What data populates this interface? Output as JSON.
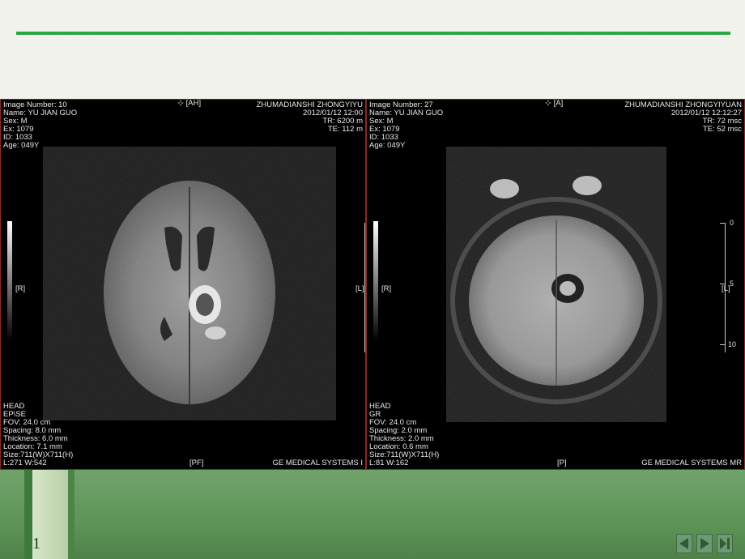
{
  "slide": {
    "number": "1"
  },
  "panels": [
    {
      "image_number": "Image Number: 10",
      "name": "Name: YU JIAN  GUO",
      "sex": "Sex: M",
      "ex": "Ex: 1079",
      "id": "ID: 1033",
      "age": "Age: 049Y",
      "orient_top": "[AH]",
      "hospital": "ZHUMADIANSHI ZHONGYIYU",
      "datetime": "2012/01/12 12:00",
      "tr": "TR: 6200 m",
      "te": "TE: 112 m",
      "side_left": "[R]",
      "side_right": "[L]",
      "region": "HEAD",
      "sequence": "EP\\SE",
      "fov": "FOV: 24.0 cm",
      "spacing": "Spacing: 8.0 mm",
      "thickness": "Thickness: 6.0 mm",
      "location": "Location: 7.1 mm",
      "size": "Size:711(W)X711(H)",
      "window": "L:271  W:542",
      "orient_bottom": "[PF]",
      "manufacturer": "GE MEDICAL SYSTEMS I"
    },
    {
      "image_number": "Image Number: 27",
      "name": "Name: YU JIAN  GUO",
      "sex": "Sex: M",
      "ex": "Ex: 1079",
      "id": "ID: 1033",
      "age": "Age: 049Y",
      "orient_top": "[A]",
      "hospital": "ZHUMADIANSHI ZHONGYIYUAN",
      "datetime": "2012/01/12 12:12:27",
      "tr": "TR: 72 msc",
      "te": "TE: 52 msc",
      "side_left": "[R]",
      "side_right": "[L]",
      "region": "HEAD",
      "sequence": "GR",
      "fov": "FOV: 24.0 cm",
      "spacing": "Spacing: 2.0 mm",
      "thickness": "Thickness: 2.0 mm",
      "location": "Location: 0.6 mm",
      "size": "Size:711(W)X711(H)",
      "window": "L:81  W:162",
      "orient_bottom": "[P]",
      "manufacturer": "GE MEDICAL SYSTEMS MR",
      "scale_labels": [
        "0",
        "5",
        "10"
      ]
    }
  ],
  "nav": {
    "first_icon": "triangle-left-icon",
    "next_icon": "triangle-right-icon",
    "last_icon": "skip-end-icon"
  },
  "colors": {
    "title_rule": "#2aa745",
    "footer_green": "#5e9458",
    "panel_border": "#8a2a2a"
  }
}
